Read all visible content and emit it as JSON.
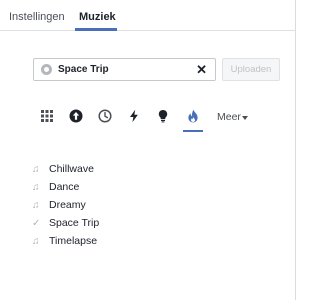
{
  "tabs": [
    {
      "label": "Instellingen"
    },
    {
      "label": "Muziek"
    }
  ],
  "search": {
    "value": "Space Trip",
    "clear_icon": "close-icon"
  },
  "upload_label": "Uploaden",
  "categories": [
    {
      "icon": "grid-icon"
    },
    {
      "icon": "arrow-up-circle-icon"
    },
    {
      "icon": "clock-icon"
    },
    {
      "icon": "lightning-icon"
    },
    {
      "icon": "lightbulb-icon"
    },
    {
      "icon": "fire-icon",
      "selected": true
    }
  ],
  "more_label": "Meer",
  "tracks": [
    {
      "label": "Chillwave",
      "icon": "music-note-icon"
    },
    {
      "label": "Dance",
      "icon": "music-note-icon"
    },
    {
      "label": "Dreamy",
      "icon": "music-note-icon"
    },
    {
      "label": "Space Trip",
      "icon": "check-icon"
    },
    {
      "label": "Timelapse",
      "icon": "music-note-icon"
    }
  ],
  "colors": {
    "accent": "#4a6fb8",
    "muted_icon": "#b0b3b8",
    "text": "#1d2129"
  }
}
